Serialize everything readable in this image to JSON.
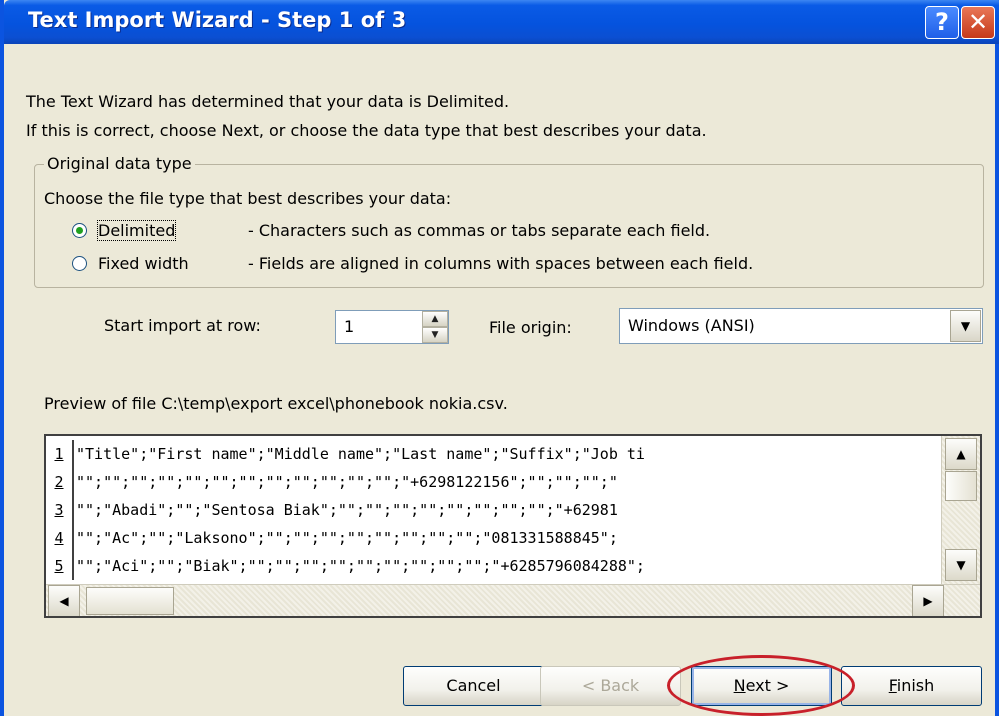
{
  "window": {
    "title": "Text Import Wizard - Step 1 of 3",
    "help_symbol": "?",
    "close_symbol": "✕"
  },
  "intro": {
    "line1": "The Text Wizard has determined that your data is Delimited.",
    "line2": "If this is correct, choose Next, or choose the data type that best describes your data."
  },
  "data_type": {
    "legend": "Original data type",
    "prompt": "Choose the file type that best describes your data:",
    "options": [
      {
        "label": "Delimited",
        "description": "- Characters such as commas or tabs separate each field.",
        "selected": true
      },
      {
        "label": "Fixed width",
        "description": "- Fields are aligned in columns with spaces between each field.",
        "selected": false
      }
    ]
  },
  "import": {
    "start_row_label": "Start import at row:",
    "start_row_value": "1",
    "file_origin_label": "File origin:",
    "file_origin_value": "Windows (ANSI)"
  },
  "preview": {
    "label": "Preview of file C:\\temp\\export excel\\phonebook nokia.csv.",
    "rows": [
      {
        "num": "1",
        "text": "\"Title\";\"First name\";\"Middle name\";\"Last name\";\"Suffix\";\"Job ti"
      },
      {
        "num": "2",
        "text": "\"\";\"\";\"\";\"\";\"\";\"\";\"\";\"\";\"\";\"\";\"\";\"\";\"+6298122156\";\"\";\"\";\"\";\""
      },
      {
        "num": "3",
        "text": "\"\";\"Abadi\";\"\";\"Sentosa Biak\";\"\";\"\";\"\";\"\";\"\";\"\";\"\";\"\";\"+62981"
      },
      {
        "num": "4",
        "text": "\"\";\"Ac\";\"\";\"Laksono\";\"\";\"\";\"\";\"\";\"\";\"\";\"\";\"\";\"081331588845\";"
      },
      {
        "num": "5",
        "text": "\"\";\"Aci\";\"\";\"Biak\";\"\";\"\";\"\";\"\";\"\";\"\";\"\";\"\";\"\";\"+6285796084288\";"
      }
    ]
  },
  "buttons": {
    "cancel": "Cancel",
    "back": "< Back",
    "next_underlined": "N",
    "next_rest": "ext >",
    "finish_underlined": "F",
    "finish_rest": "inish"
  },
  "annotation_color": "#c8202a"
}
